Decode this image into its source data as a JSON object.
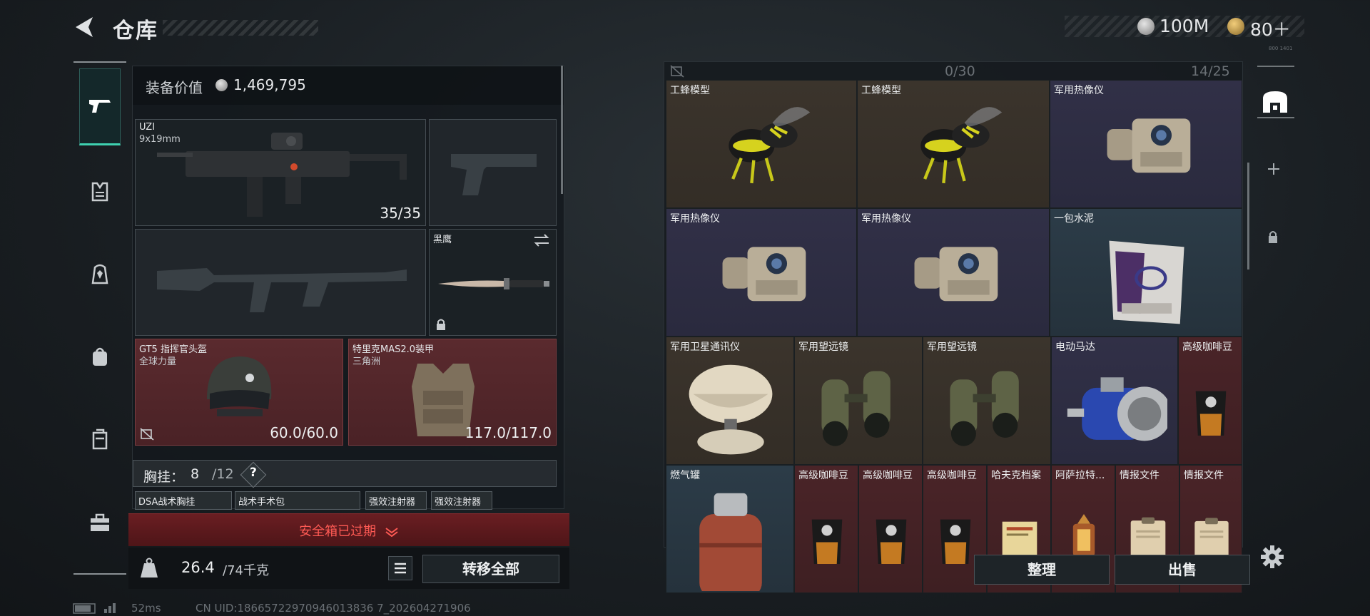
{
  "header": {
    "title": "仓库",
    "currency1": "100M",
    "currency2": "80＋",
    "version_tag": "800 1401"
  },
  "nav": {
    "items": [
      "pistol",
      "vest",
      "backpack-armor",
      "backpack",
      "case",
      "toolbox"
    ]
  },
  "equipment": {
    "label": "装备价值",
    "value": "1,469,795",
    "primary": {
      "name": "UZI",
      "caliber": "9x19mm",
      "ammo": "35/35"
    },
    "melee": {
      "name": "黑鹰"
    },
    "helmet": {
      "name": "GT5 指挥官头盔",
      "sub": "全球力量",
      "durability": "60.0/60.0"
    },
    "armor": {
      "name": "特里克MAS2.0装甲",
      "sub": "三角洲",
      "durability": "117.0/117.0"
    },
    "chest": {
      "label": "胸挂：",
      "count": "8",
      "total": "/12",
      "help": "?"
    },
    "mini_items": [
      "DSA战术胸挂",
      "战术手术包",
      "强效注射器",
      "强效注射器"
    ],
    "safe_banner": "安全箱已过期",
    "weight": {
      "value": "26.4",
      "max": "/74千克"
    },
    "transfer_label": "转移全部"
  },
  "status": {
    "signal": "",
    "ping": "52ms",
    "uid": "CN UID:18665722970946013836 7_202604271906"
  },
  "storage": {
    "counter1": "0/30",
    "counter2": "14/25",
    "items": [
      {
        "name": "工蜂模型",
        "rarity": "brown"
      },
      {
        "name": "工蜂模型",
        "rarity": "brown"
      },
      {
        "name": "军用热像仪",
        "rarity": "purple"
      },
      {
        "name": "军用热像仪",
        "rarity": "purple"
      },
      {
        "name": "军用热像仪",
        "rarity": "purple"
      },
      {
        "name": "一包水泥",
        "rarity": "blue"
      },
      {
        "name": "军用卫星通讯仪",
        "rarity": "brown"
      },
      {
        "name": "军用望远镜",
        "rarity": "brown"
      },
      {
        "name": "军用望远镜",
        "rarity": "brown"
      },
      {
        "name": "电动马达",
        "rarity": "purple"
      },
      {
        "name": "高级咖啡豆",
        "rarity": "red"
      },
      {
        "name": "燃气罐",
        "rarity": "blue"
      },
      {
        "name": "高级咖啡豆",
        "rarity": "red"
      },
      {
        "name": "高级咖啡豆",
        "rarity": "red"
      },
      {
        "name": "高级咖啡豆",
        "rarity": "red"
      },
      {
        "name": "哈夫克档案",
        "rarity": "red"
      },
      {
        "name": "阿萨拉特...",
        "rarity": "red"
      },
      {
        "name": "情报文件",
        "rarity": "red"
      },
      {
        "name": "情报文件",
        "rarity": "red"
      }
    ],
    "sort_label": "整理",
    "sell_label": "出售"
  },
  "colors": {
    "accent_teal": "#3fd1b0",
    "rarity_red": "#4a2428",
    "rarity_purple": "#313047",
    "rarity_blue": "#2c3c48",
    "rarity_brown": "#3b342c",
    "warning_red": "#ff5a54"
  }
}
